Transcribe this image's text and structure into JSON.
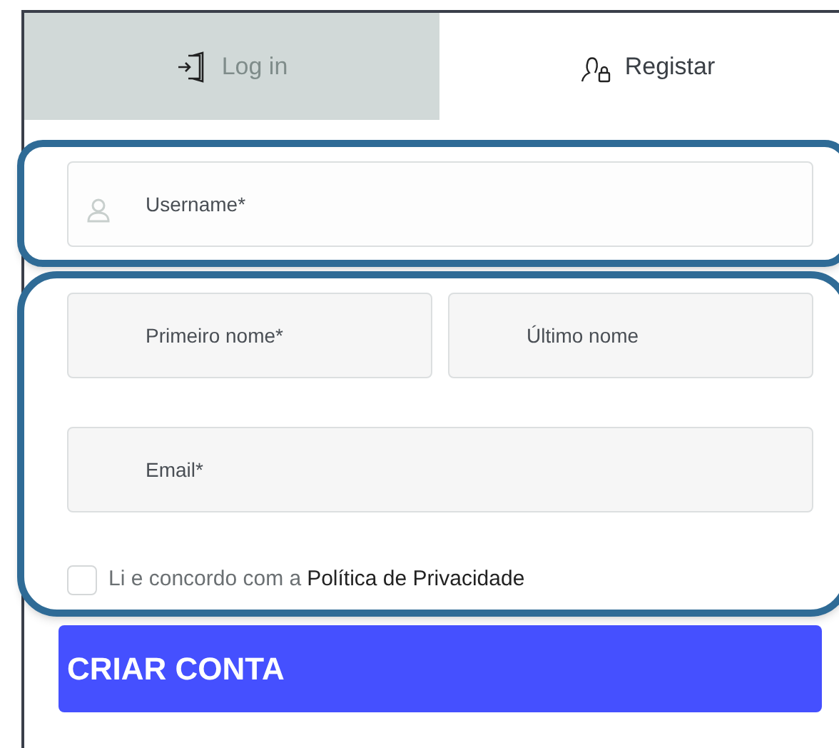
{
  "tabs": [
    {
      "label": "Log in",
      "selected": false
    },
    {
      "label": "Registar",
      "selected": true
    }
  ],
  "username": {
    "placeholder": "Username*"
  },
  "first_name": {
    "placeholder": "Primeiro nome*"
  },
  "last_name": {
    "placeholder": "Último nome"
  },
  "email": {
    "placeholder": "Email*"
  },
  "privacy": {
    "checked": false,
    "text": "Li e concordo com a",
    "link": "Política de Privacidade"
  },
  "submit": "CRIAR CONTA"
}
